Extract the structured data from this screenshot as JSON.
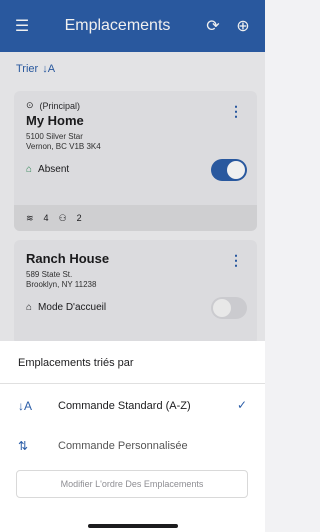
{
  "header": {
    "title": "Emplacements"
  },
  "sort": {
    "label": "Trier"
  },
  "locations": [
    {
      "tag": "(Principal)",
      "name": "My Home",
      "address1": "5100 Silver Star",
      "address2": "Vernon, BC V1B 3K4",
      "mode": "Absent",
      "toggle": "on",
      "wifi_count": "4",
      "people_count": "2"
    },
    {
      "name": "Ranch House",
      "address1": "589 State St.",
      "address2": "Brooklyn, NY 11238",
      "mode": "Mode D'accueil",
      "toggle": "off"
    }
  ],
  "sheet": {
    "title": "Emplacements triés par",
    "options": [
      {
        "label": "Commande Standard (A-Z)",
        "selected": true
      },
      {
        "label": "Commande Personnalisée",
        "selected": false
      }
    ],
    "button": "Modifier L'ordre Des Emplacements"
  },
  "colors": {
    "accent": "#2c5ea8"
  }
}
